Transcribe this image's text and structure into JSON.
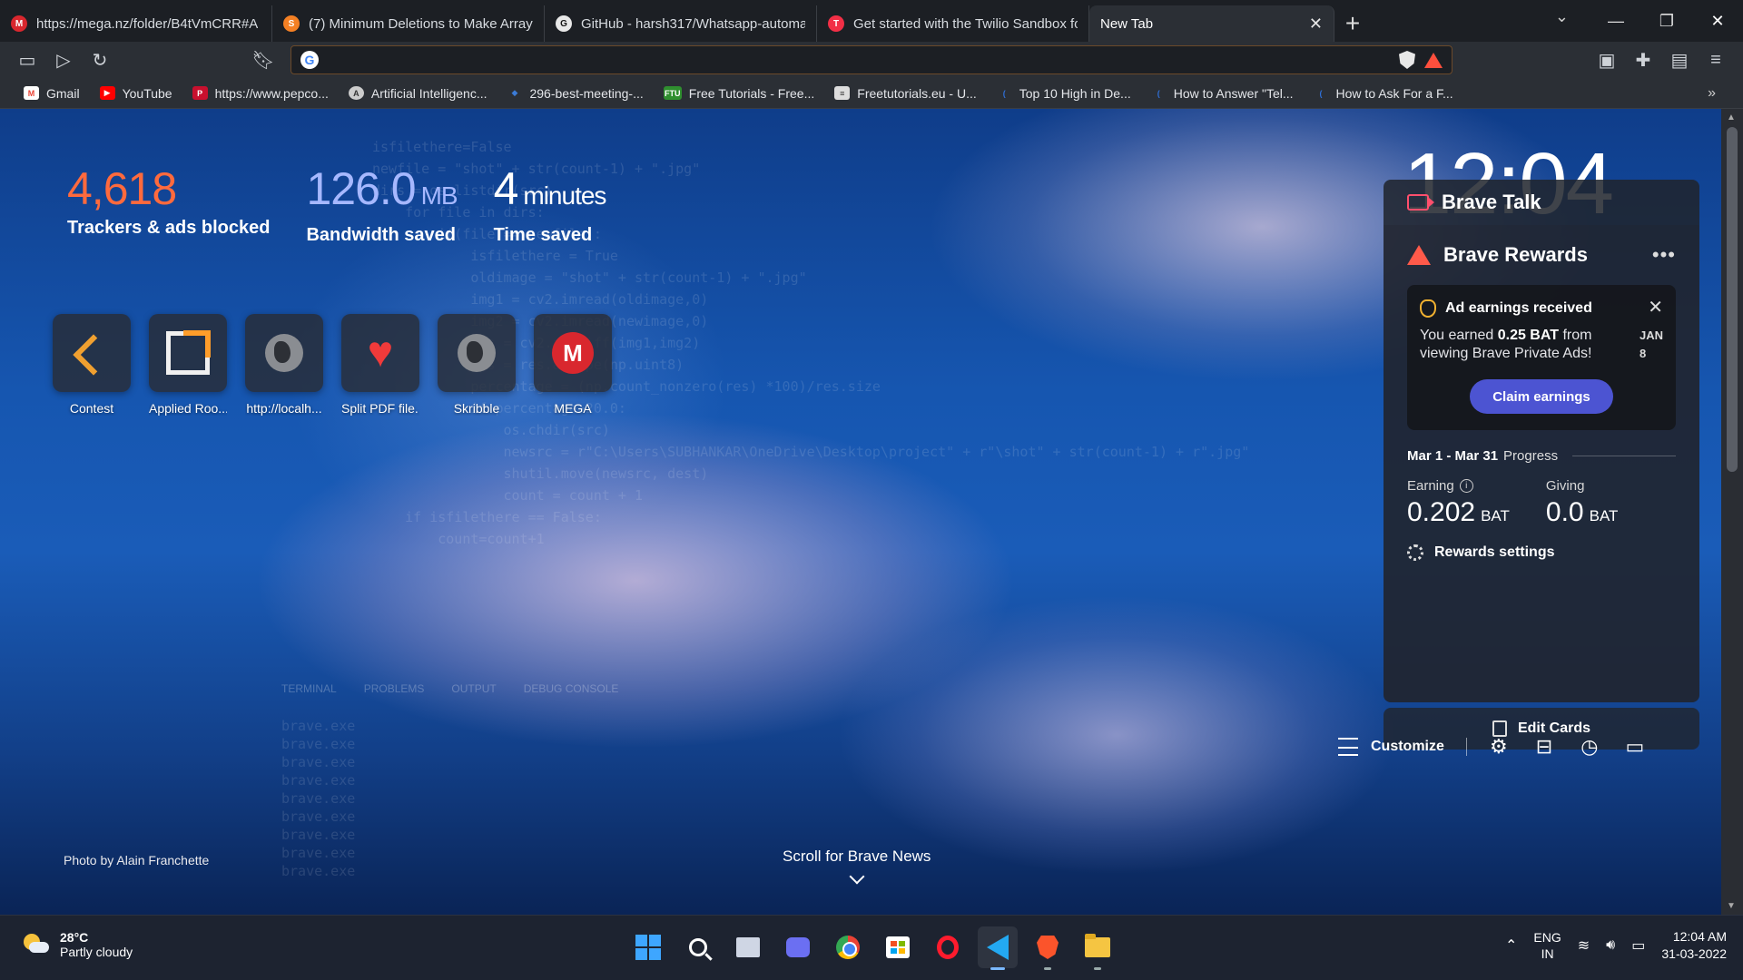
{
  "tabs": [
    {
      "title": "https://mega.nz/folder/B4tVmCRR#A",
      "favicon": "mega-icon",
      "color": "#d9272e",
      "glyph": "M"
    },
    {
      "title": "(7) Minimum Deletions to Make Array",
      "favicon": "stackoverflow-icon",
      "color": "#f48024",
      "glyph": "S"
    },
    {
      "title": "GitHub - harsh317/Whatsapp-automa",
      "favicon": "github-icon",
      "color": "#e8e8e8",
      "glyph": "G"
    },
    {
      "title": "Get started with the Twilio Sandbox fo",
      "favicon": "twilio-icon",
      "color": "#f22f46",
      "glyph": "T"
    },
    {
      "title": "New Tab",
      "favicon": "",
      "color": "",
      "glyph": ""
    }
  ],
  "address_bar": {
    "value": "",
    "placeholder": ""
  },
  "bookmarks": [
    {
      "label": "Gmail",
      "color": "#ea4335",
      "glyph": "M"
    },
    {
      "label": "YouTube",
      "color": "#ff0000",
      "glyph": "▶"
    },
    {
      "label": "https://www.pepco...",
      "color": "#c8102e",
      "glyph": "P"
    },
    {
      "label": "Artificial Intelligenc...",
      "color": "#cccccc",
      "glyph": "A"
    },
    {
      "label": "296-best-meeting-...",
      "color": "#3b7bd6",
      "glyph": "◆"
    },
    {
      "label": "Free Tutorials - Free...",
      "color": "#2f8f2f",
      "glyph": "FTU"
    },
    {
      "label": "Freetutorials.eu - U...",
      "color": "#dddddd",
      "glyph": "≡"
    },
    {
      "label": "Top 10 High in De...",
      "color": "#2f6fd6",
      "glyph": "("
    },
    {
      "label": "How to Answer \"Tel...",
      "color": "#2f6fd6",
      "glyph": "("
    },
    {
      "label": "How to Ask For a F...",
      "color": "#2f6fd6",
      "glyph": "("
    }
  ],
  "stats": {
    "trackers": {
      "value": "4,618",
      "label": "Trackers & ads blocked"
    },
    "bandwidth": {
      "value": "126.0",
      "unit": "MB",
      "label": "Bandwidth saved"
    },
    "time": {
      "value": "4",
      "unit": "minutes",
      "label": "Time saved"
    }
  },
  "top_sites": [
    {
      "name": "Contest",
      "icon": "contest-icon"
    },
    {
      "name": "Applied Roo...",
      "icon": "applied-room-icon"
    },
    {
      "name": "http://localh...",
      "icon": "globe-icon"
    },
    {
      "name": "Split PDF file...",
      "icon": "heart-icon"
    },
    {
      "name": "Skribble",
      "icon": "globe-icon"
    },
    {
      "name": "MEGA",
      "icon": "mega-icon"
    }
  ],
  "clock": "12:04",
  "brave_talk": {
    "title": "Brave Talk"
  },
  "rewards": {
    "title": "Brave Rewards",
    "ad": {
      "title": "Ad earnings received",
      "text_before": "You earned ",
      "amount": "0.25 BAT",
      "text_after": " from viewing Brave Private Ads!",
      "date": "JAN 8",
      "button": "Claim earnings"
    },
    "period": "Mar 1 - Mar 31",
    "period_suffix": "Progress",
    "earning_label": "Earning",
    "earning_value": "0.202",
    "giving_label": "Giving",
    "giving_value": "0.0",
    "unit": "BAT",
    "settings": "Rewards settings"
  },
  "edit_cards": "Edit Cards",
  "photo_credit": "Photo by Alain Franchette",
  "scroll_news": "Scroll for Brave News",
  "customize": "Customize",
  "ghost": {
    "code": "isfilethere=False\nnewfile = \"shot\" + str(count-1) + \".jpg\"\ndirs = os.listdir(src)\n    for file in dirs:\n        if(file == newfile):\n            isfilethere = True\n            oldimage = \"shot\" + str(count-1) + \".jpg\"\n            img1 = cv2.imread(oldimage,0)\n            img2 = cv2.imread(newimage,0)\n            res = cv2.absdiff(img1,img2)\n            res = res.astype(np.uint8)\n            percentage = (np.count_nonzero(res) *100)/res.size\n            if percentage>20.0:\n                os.chdir(src)\n                newsrc = r\"C:\\Users\\SUBHANKAR\\OneDrive\\Desktop\\project\" + r\"\\shot\" + str(count-1) + r\".jpg\"\n                shutil.move(newsrc, dest)\n                count = count + 1\n    if isfilethere == False:\n        count=count+1",
    "terminal": "brave.exe\nbrave.exe\nbrave.exe\nbrave.exe\nbrave.exe\nbrave.exe\nbrave.exe\nbrave.exe\nbrave.exe",
    "panel_tabs": [
      "TERMINAL",
      "PROBLEMS",
      "OUTPUT",
      "DEBUG CONSOLE"
    ]
  },
  "taskbar": {
    "weather_temp": "28°C",
    "weather_desc": "Partly cloudy",
    "lang1": "ENG",
    "lang2": "IN",
    "time": "12:04 AM",
    "date": "31-03-2022"
  }
}
